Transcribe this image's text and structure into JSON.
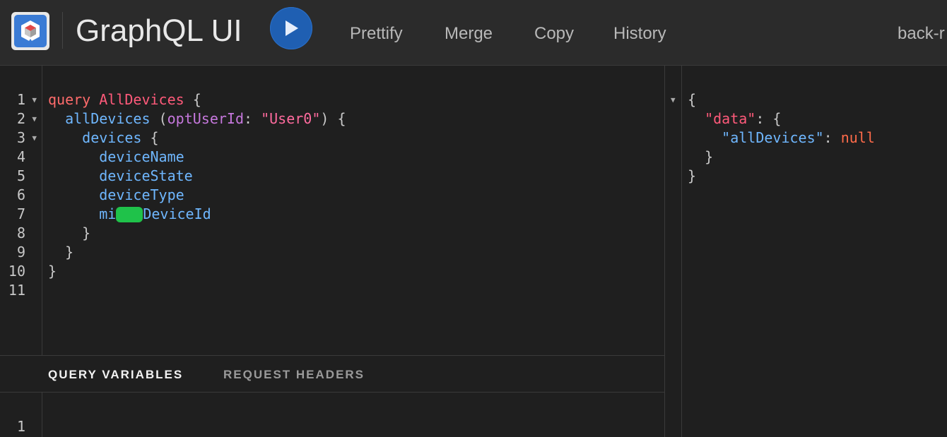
{
  "app": {
    "title": "GraphQL UI"
  },
  "toolbar": {
    "run_icon": "play-icon",
    "buttons": [
      "Prettify",
      "Merge",
      "Copy",
      "History"
    ],
    "endpoint_label": "back-r"
  },
  "query_editor": {
    "line_numbers": [
      "1",
      "2",
      "3",
      "4",
      "5",
      "6",
      "7",
      "8",
      "9",
      "10",
      "11"
    ],
    "lines": {
      "l1_kw": "query",
      "l1_name": "AllDevices",
      "l1_rest": " {",
      "l2_field": "allDevices",
      "l2_p1": " (",
      "l2_arg": "optUserId",
      "l2_p2": ": ",
      "l2_str": "\"User0\"",
      "l2_p3": ") {",
      "l3_field": "devices",
      "l3_rest": " {",
      "l4_field": "deviceName",
      "l5_field": "deviceState",
      "l6_field": "deviceType",
      "l7_prefix": "mi",
      "l7_suffix": "DeviceId",
      "l8": "}",
      "l9": "}",
      "l10": "}"
    }
  },
  "variables_panel": {
    "tabs": [
      "QUERY VARIABLES",
      "REQUEST HEADERS"
    ],
    "line_numbers": [
      "1"
    ]
  },
  "result": {
    "open_brace": "{",
    "data_key": "\"data\"",
    "colon_open": ": {",
    "all_devices_key": "\"allDevices\"",
    "colon": ": ",
    "value": "null",
    "close_inner": "}",
    "close_outer": "}"
  },
  "colors": {
    "toolbar_bg": "#2b2b2b",
    "editor_bg": "#1f1f1f",
    "run_button": "#1f5fb2",
    "keyword": "#ff6b6b",
    "field": "#6fb7ff",
    "argument": "#c678dd",
    "string": "#ff6b9e",
    "redaction": "#1fc24a"
  }
}
